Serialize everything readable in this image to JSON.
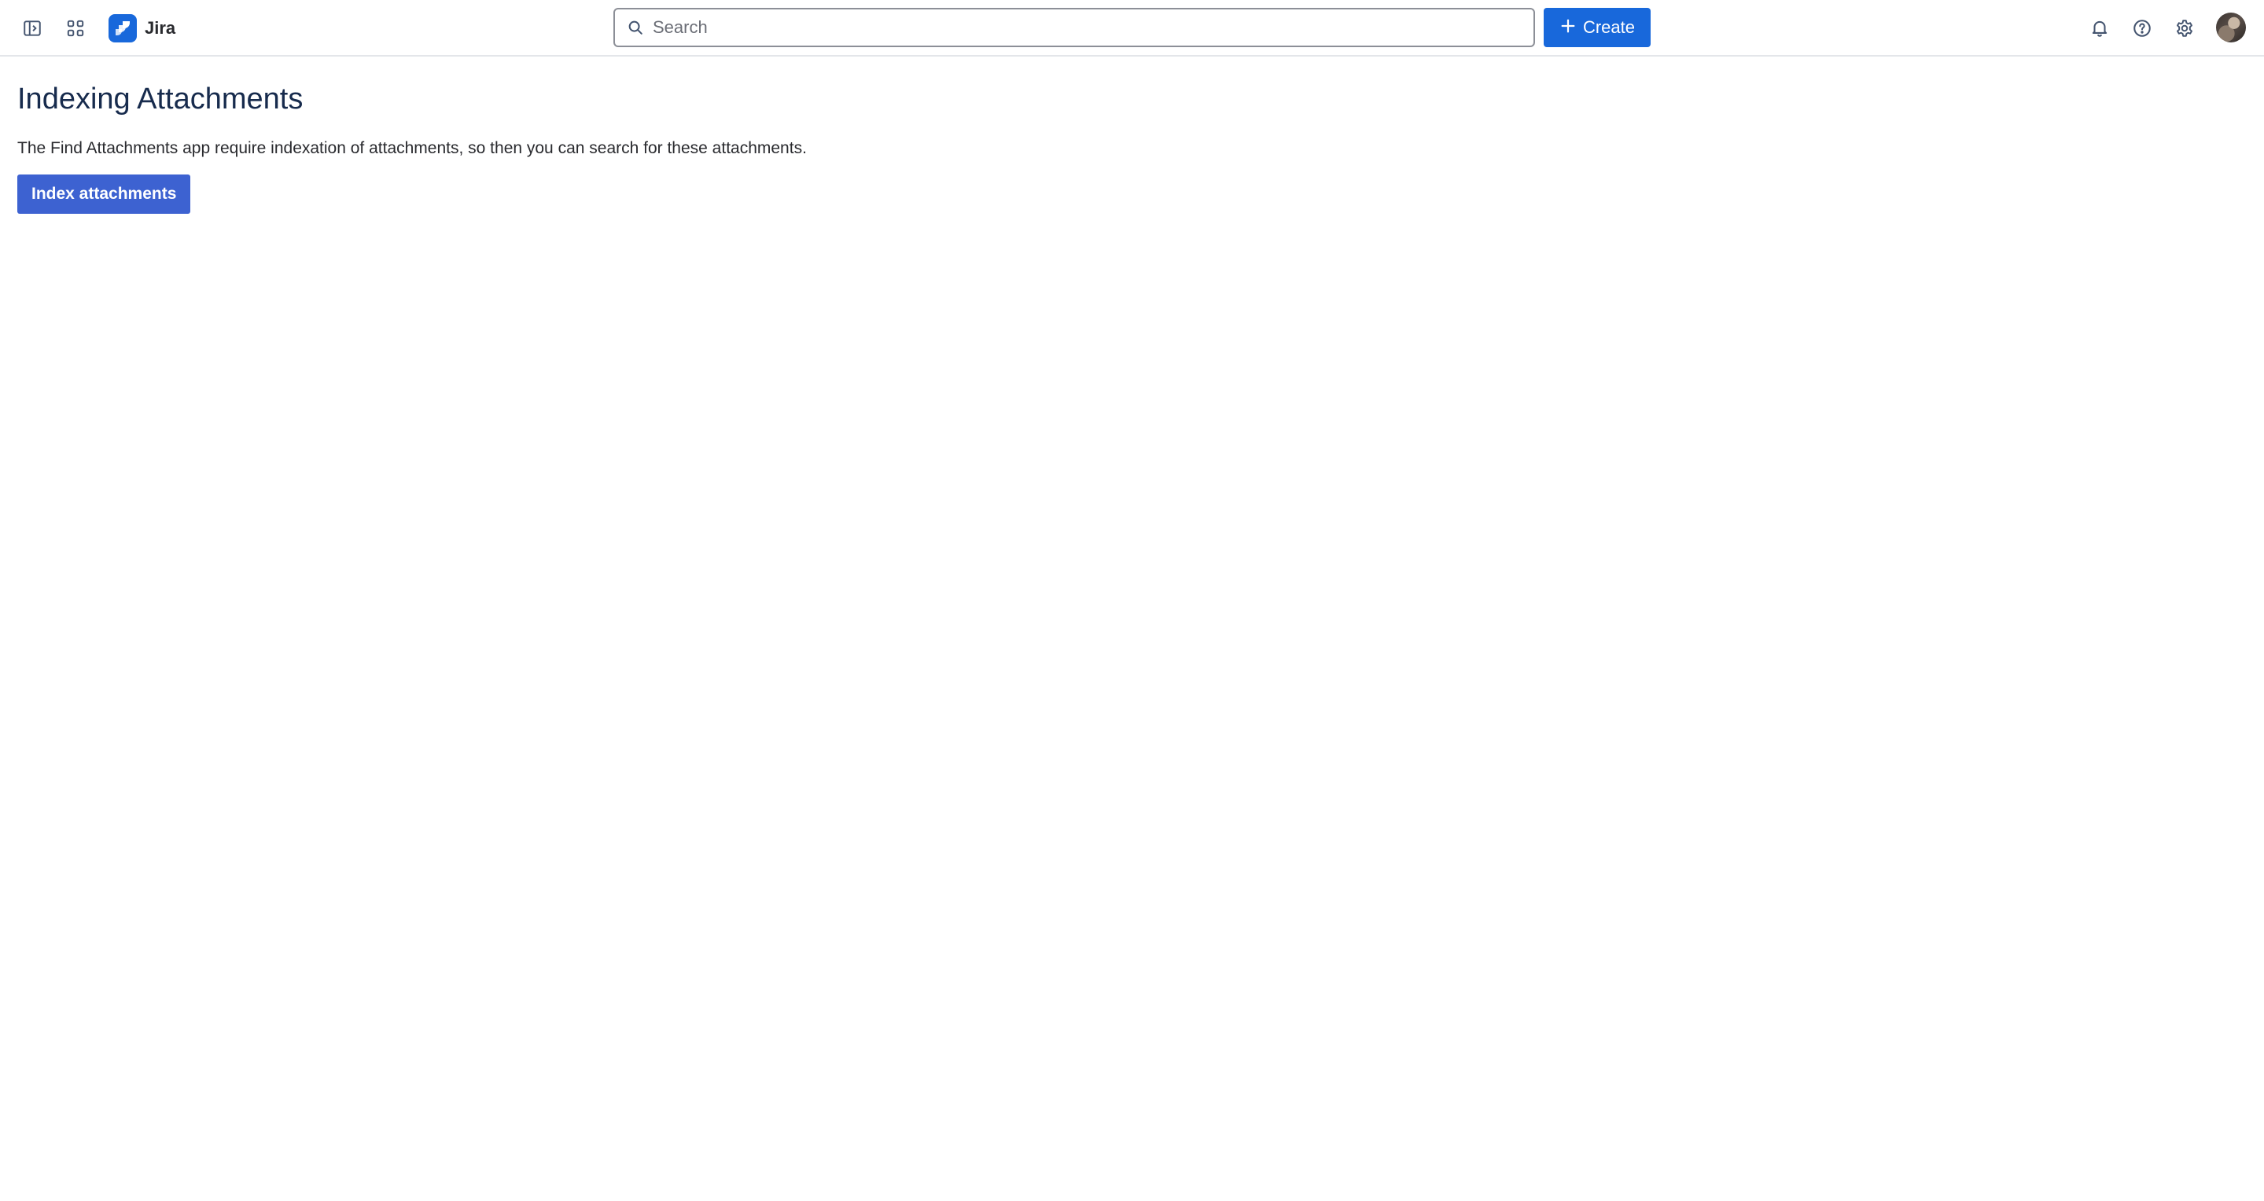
{
  "app": {
    "name": "Jira",
    "accent_color": "#1868db",
    "button_color": "#3d62d1"
  },
  "topbar": {
    "sidebar_toggle_icon": "sidebar-toggle-icon",
    "app_switcher_icon": "app-switcher-icon",
    "search_placeholder": "Search",
    "create_label": "Create",
    "notifications_icon": "bell-icon",
    "help_icon": "help-icon",
    "settings_icon": "gear-icon"
  },
  "main": {
    "title": "Indexing Attachments",
    "description": "The Find Attachments app require indexation of attachments, so then you can search for these attachments.",
    "index_button_label": "Index attachments"
  }
}
